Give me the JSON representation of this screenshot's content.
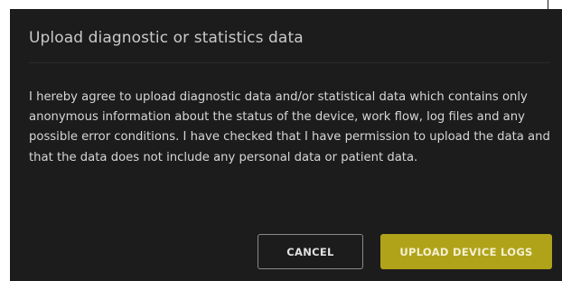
{
  "dialog": {
    "title": "Upload diagnostic or statistics data",
    "body": "I hereby agree to upload diagnostic data and/or statistical data which contains only anonymous information about the status of the device, work flow, log files and any possible error conditions. I have checked that I have permission to upload the data and that the data does not include any personal data or patient data.",
    "cancel_label": "CANCEL",
    "confirm_label": "UPLOAD DEVICE LOGS"
  },
  "colors": {
    "dialog_background": "#1c1c1c",
    "accent": "#b0a31a",
    "text": "#d6d6d6"
  }
}
